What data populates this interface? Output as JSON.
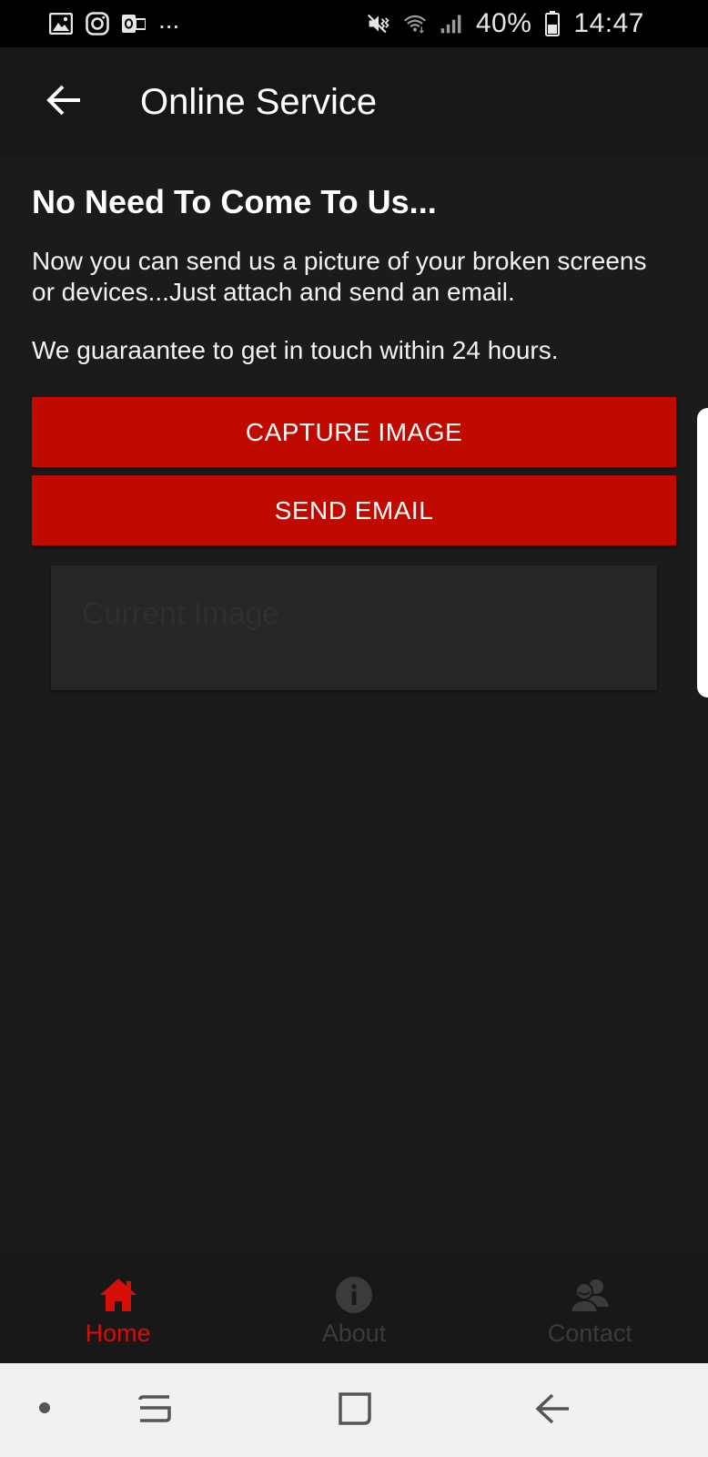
{
  "status_bar": {
    "left_icons": [
      "gallery-icon",
      "instagram-icon",
      "outlook-icon"
    ],
    "more_indicator": "...",
    "right_icons": [
      "mute-icon",
      "wifi-icon",
      "signal-icon"
    ],
    "battery_percent": "40%",
    "battery_icon": "battery-icon",
    "time": "14:47"
  },
  "app_bar": {
    "back_icon": "arrow-left-icon",
    "title": "Online Service"
  },
  "content": {
    "headline": "No Need To Come To Us...",
    "paragraph_1": "Now you can send us a picture of your broken screens or devices...Just attach and send an email.",
    "paragraph_2": "We guaraantee to get in touch within 24 hours.",
    "capture_button": "CAPTURE IMAGE",
    "send_button": "SEND EMAIL",
    "image_placeholder": "Current Image"
  },
  "bottom_nav": {
    "items": [
      {
        "label": "Home",
        "icon": "home-icon",
        "active": true
      },
      {
        "label": "About",
        "icon": "info-icon",
        "active": false
      },
      {
        "label": "Contact",
        "icon": "contact-icon",
        "active": false
      }
    ]
  },
  "colors": {
    "accent": "#c00a00",
    "active_nav": "#d40f08",
    "background": "#1b1b1b"
  }
}
